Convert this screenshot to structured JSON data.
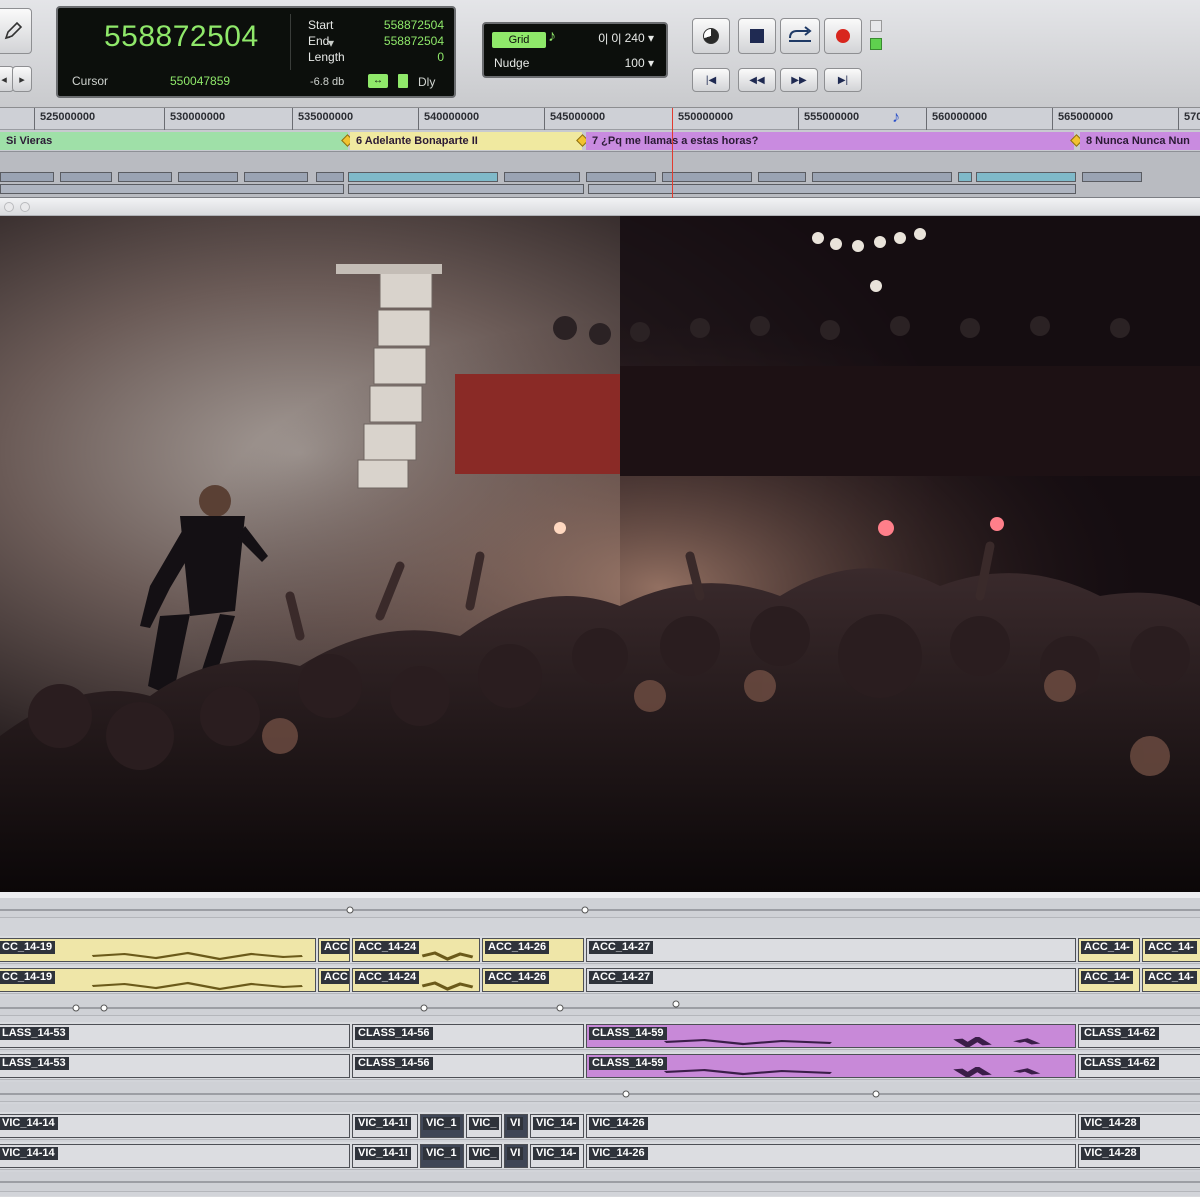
{
  "counter": {
    "main": "558872504",
    "start_label": "Start",
    "start_value": "558872504",
    "end_label": "End",
    "end_value": "558872504",
    "length_label": "Length",
    "length_value": "0",
    "cursor_label": "Cursor",
    "cursor_value": "550047859",
    "db_value": "-6.8 db",
    "delay_label": "Dly"
  },
  "grid": {
    "badge": "Grid",
    "value": "0| 0| 240",
    "nudge_label": "Nudge",
    "nudge_value": "100"
  },
  "ruler": {
    "labels": [
      "525000000",
      "530000000",
      "535000000",
      "540000000",
      "545000000",
      "550000000",
      "555000000",
      "560000000",
      "565000000",
      "570"
    ]
  },
  "markers": {
    "m1": "Si Vieras",
    "m2": "6 Adelante Bonaparte II",
    "m3": "7 ¿Pq me llamas a estas horas?",
    "m4": "8 Nunca Nunca Nun"
  },
  "tracks": {
    "acc": [
      "CC_14-19",
      "ACC",
      "ACC_14-24",
      "ACC_14-26",
      "ACC_14-27",
      "ACC_14-",
      "ACC_14-"
    ],
    "class": [
      "LASS_14-53",
      "CLASS_14-56",
      "CLASS_14-59",
      "CLASS_14-62"
    ],
    "vic": [
      "VIC_14-14",
      "VIC_14-1!",
      "VIC_1",
      "VIC_",
      "VI",
      "VIC_14-",
      "VIC_14-26",
      "VIC_14-28"
    ]
  },
  "colors": {
    "counter_green": "#8fe86a",
    "marker_green": "#9fe0a8",
    "marker_yellow": "#f0e9a0",
    "marker_purple": "#c98be0",
    "clip_yellow": "#efe6a8",
    "clip_purple": "#c889d8",
    "record_red": "#d8261e"
  },
  "icons": [
    "pencil-icon",
    "nudge-left-icon",
    "nudge-right-icon",
    "metronome-icon",
    "stop-icon",
    "loop-icon",
    "record-icon",
    "go-to-start-icon",
    "rewind-icon",
    "fast-forward-icon",
    "go-to-end-icon"
  ]
}
